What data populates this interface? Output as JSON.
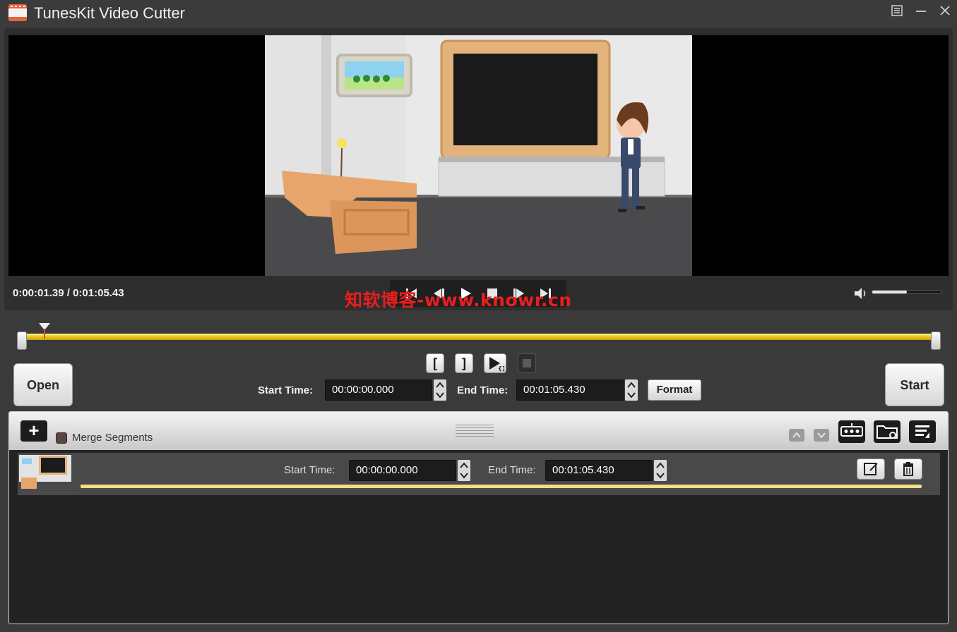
{
  "window": {
    "title": "TunesKit Video Cutter",
    "controls": [
      "menu-icon",
      "minimize-icon",
      "close-icon"
    ]
  },
  "player": {
    "current_time": "0:00:01.39",
    "separator": " / ",
    "duration": "0:01:05.43",
    "watermark": "知软博客-www.knowr.cn",
    "volume_level": 0.5,
    "controls": [
      "previous-frame-icon",
      "step-back-icon",
      "play-icon",
      "stop-icon",
      "step-forward-icon",
      "next-frame-icon"
    ]
  },
  "timeline": {
    "playhead_fraction": 0.03
  },
  "trim": {
    "open_label": "Open",
    "start_label": "Start",
    "start_time_label": "Start Time:",
    "start_time_value": "00:00:00.000",
    "end_time_label": "End Time:",
    "end_time_value": "00:01:05.430",
    "format_label": "Format",
    "mark_in": "[",
    "mark_out": "]"
  },
  "segments": {
    "add_label": "+",
    "merge_label": "Merge Segments",
    "merge_checked": false,
    "rows": [
      {
        "start_time_label": "Start Time:",
        "start_time_value": "00:00:00.000",
        "end_time_label": "End Time:",
        "end_time_value": "00:01:05.430"
      }
    ]
  },
  "colors": {
    "accent_yellow": "#e6c919",
    "segment_bar": "#f1df83",
    "watermark_red": "#ea1e1e",
    "panel_dark": "#232323"
  }
}
